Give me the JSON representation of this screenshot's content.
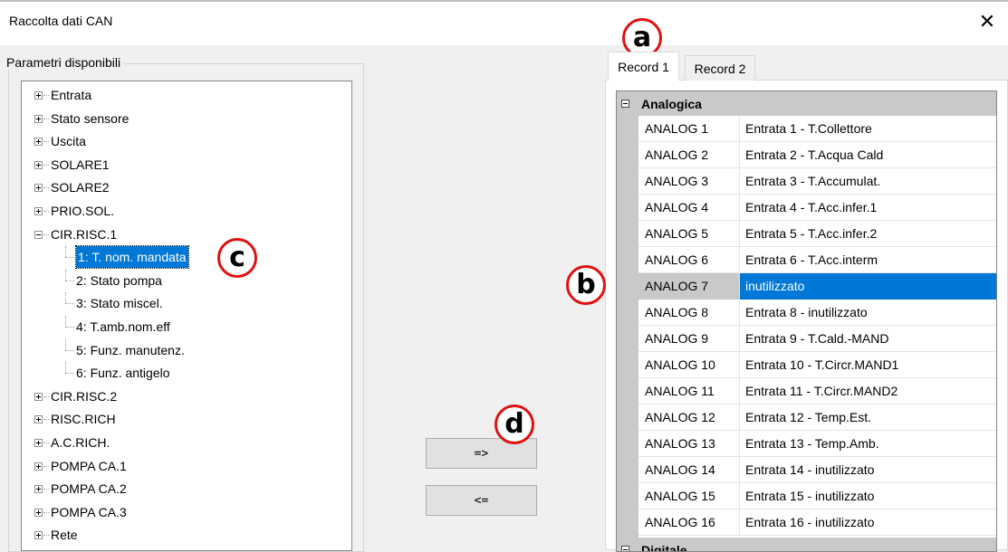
{
  "window": {
    "title": "Raccolta dati CAN",
    "close_glyph": "✕"
  },
  "params_group": {
    "legend": "Parametri disponibili",
    "tree": [
      {
        "label": "Entrata",
        "expanded": false
      },
      {
        "label": "Stato sensore",
        "expanded": false
      },
      {
        "label": "Uscita",
        "expanded": false
      },
      {
        "label": "SOLARE1",
        "expanded": false
      },
      {
        "label": "SOLARE2",
        "expanded": false
      },
      {
        "label": "PRIO.SOL.",
        "expanded": false
      },
      {
        "label": "CIR.RISC.1",
        "expanded": true
      },
      {
        "label": "1: T. nom. mandata",
        "child": true,
        "selected": true
      },
      {
        "label": "2: Stato pompa",
        "child": true
      },
      {
        "label": "3: Stato miscel.",
        "child": true
      },
      {
        "label": "4: T.amb.nom.eff",
        "child": true
      },
      {
        "label": "5: Funz. manutenz.",
        "child": true
      },
      {
        "label": "6: Funz. antigelo",
        "child": true
      },
      {
        "label": "CIR.RISC.2",
        "expanded": false
      },
      {
        "label": "RISC.RICH",
        "expanded": false
      },
      {
        "label": "A.C.RICH.",
        "expanded": false
      },
      {
        "label": "POMPA CA.1",
        "expanded": false
      },
      {
        "label": "POMPA CA.2",
        "expanded": false
      },
      {
        "label": "POMPA CA.3",
        "expanded": false
      },
      {
        "label": "Rete",
        "expanded": false
      }
    ]
  },
  "buttons": {
    "add": "=>",
    "remove": "<="
  },
  "tabs": [
    {
      "label": "Record 1",
      "active": true
    },
    {
      "label": "Record 2",
      "active": false
    }
  ],
  "grid": {
    "category": "Analogica",
    "category2": "Digitale",
    "rows": [
      {
        "name": "ANALOG 1",
        "value": "Entrata 1 - T.Collettore"
      },
      {
        "name": "ANALOG 2",
        "value": "Entrata 2 - T.Acqua Cald"
      },
      {
        "name": "ANALOG 3",
        "value": "Entrata 3 - T.Accumulat."
      },
      {
        "name": "ANALOG 4",
        "value": "Entrata 4 - T.Acc.infer.1"
      },
      {
        "name": "ANALOG 5",
        "value": "Entrata 5 - T.Acc.infer.2"
      },
      {
        "name": "ANALOG 6",
        "value": "Entrata 6 - T.Acc.interm"
      },
      {
        "name": "ANALOG 7",
        "value": "inutilizzato",
        "selected": true
      },
      {
        "name": "ANALOG 8",
        "value": "Entrata 8 - inutilizzato"
      },
      {
        "name": "ANALOG 9",
        "value": "Entrata 9 - T.Cald.-MAND"
      },
      {
        "name": "ANALOG 10",
        "value": "Entrata 10 - T.Circr.MAND1"
      },
      {
        "name": "ANALOG 11",
        "value": "Entrata 11 - T.Circr.MAND2"
      },
      {
        "name": "ANALOG 12",
        "value": "Entrata 12 - Temp.Est."
      },
      {
        "name": "ANALOG 13",
        "value": "Entrata 13 - Temp.Amb."
      },
      {
        "name": "ANALOG 14",
        "value": "Entrata 14 - inutilizzato"
      },
      {
        "name": "ANALOG 15",
        "value": "Entrata 15 - inutilizzato"
      },
      {
        "name": "ANALOG 16",
        "value": "Entrata 16 - inutilizzato"
      }
    ]
  },
  "callouts": {
    "a": "a",
    "b": "b",
    "c": "c",
    "d": "d"
  },
  "colors": {
    "selection": "#0078d7",
    "callout_border": "#e01010"
  }
}
